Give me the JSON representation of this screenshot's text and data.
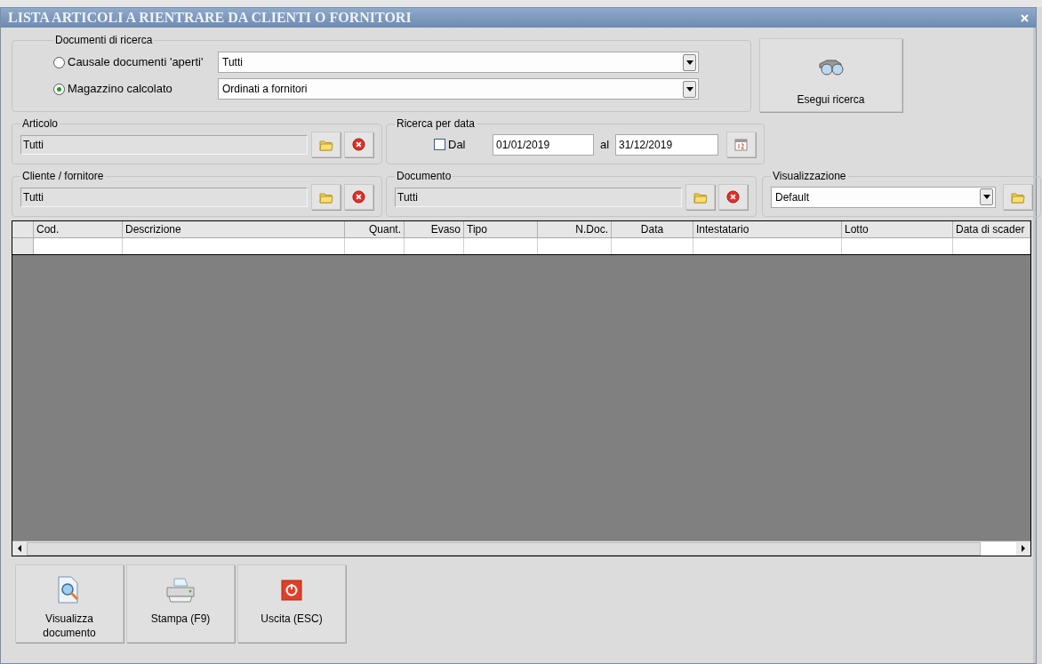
{
  "window": {
    "title": "LISTA ARTICOLI A RIENTRARE DA CLIENTI O FORNITORI"
  },
  "search_documents": {
    "title": "Documenti di ricerca",
    "options": [
      {
        "label": "Causale documenti 'aperti'",
        "selected": false,
        "value": "Tutti"
      },
      {
        "label": "Magazzino calcolato",
        "selected": true,
        "value": "Ordinati a fornitori"
      }
    ]
  },
  "search_button": {
    "label": "Esegui ricerca"
  },
  "article": {
    "title": "Articolo",
    "value": "Tutti"
  },
  "date_search": {
    "title": "Ricerca per data",
    "checkbox_label": "Dal",
    "checked": false,
    "from": "01/01/2019",
    "to_label": "al",
    "to": "31/12/2019"
  },
  "customer_supplier": {
    "title": "Cliente / fornitore",
    "value": "Tutti"
  },
  "document": {
    "title": "Documento",
    "value": "Tutti"
  },
  "view": {
    "title": "Visualizzazione",
    "value": "Default"
  },
  "table": {
    "columns": [
      {
        "label": "Cod."
      },
      {
        "label": "Descrizione"
      },
      {
        "label": "Quant."
      },
      {
        "label": "Evaso"
      },
      {
        "label": "Tipo"
      },
      {
        "label": "N.Doc."
      },
      {
        "label": "Data"
      },
      {
        "label": "Intestatario"
      },
      {
        "label": "Lotto"
      },
      {
        "label": "Data di scader"
      }
    ]
  },
  "buttons": [
    {
      "kind": "view",
      "label": "Visualizza documento"
    },
    {
      "kind": "print",
      "label": "Stampa (F9)"
    },
    {
      "kind": "exit",
      "label": "Uscita (ESC)"
    }
  ]
}
